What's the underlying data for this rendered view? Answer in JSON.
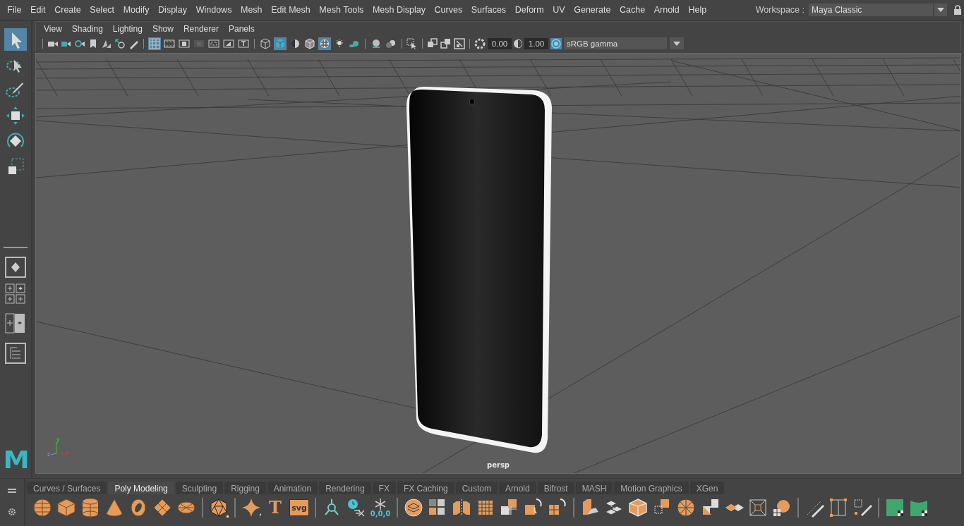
{
  "menu_bar": {
    "items": [
      "File",
      "Edit",
      "Create",
      "Select",
      "Modify",
      "Display",
      "Windows",
      "Mesh",
      "Edit Mesh",
      "Mesh Tools",
      "Mesh Display",
      "Curves",
      "Surfaces",
      "Deform",
      "UV",
      "Generate",
      "Cache",
      "Arnold",
      "Help"
    ],
    "workspace": {
      "label": "Workspace :",
      "value": "Maya Classic"
    }
  },
  "toolbox": {
    "tools": [
      {
        "kind": "select",
        "selected": true
      },
      {
        "kind": "lasso",
        "selected": false
      },
      {
        "kind": "paint",
        "selected": false
      },
      {
        "kind": "move",
        "selected": false
      },
      {
        "kind": "rotate",
        "selected": false
      },
      {
        "kind": "scale",
        "selected": false
      }
    ]
  },
  "logo": "M",
  "panel": {
    "menus": [
      "View",
      "Shading",
      "Lighting",
      "Show",
      "Renderer",
      "Panels"
    ],
    "toggles": [
      {
        "on": true
      },
      {
        "on": false
      },
      {
        "on": false
      },
      {
        "on": false
      },
      {
        "on": false
      },
      {
        "on": false
      },
      {
        "on": false
      },
      {
        "on": false
      },
      {
        "on": true
      },
      {
        "on": false
      },
      {
        "on": false
      },
      {
        "on": true
      },
      {
        "on": false
      },
      {
        "on": false
      },
      {
        "on": false
      },
      {
        "on": false
      }
    ],
    "exposure": "0.00",
    "gamma": "1.00",
    "color_management_on": true,
    "color_space": "sRGB gamma"
  },
  "viewport": {
    "camera_label": "persp",
    "axes": [
      "x",
      "y",
      "z"
    ]
  },
  "shelf": {
    "tabs": [
      {
        "label": "Curves / Surfaces",
        "selected": false
      },
      {
        "label": "Poly Modeling",
        "selected": true
      },
      {
        "label": "Sculpting",
        "selected": false
      },
      {
        "label": "Rigging",
        "selected": false
      },
      {
        "label": "Animation",
        "selected": false
      },
      {
        "label": "Rendering",
        "selected": false
      },
      {
        "label": "FX",
        "selected": false
      },
      {
        "label": "FX Caching",
        "selected": false
      },
      {
        "label": "Custom",
        "selected": false
      },
      {
        "label": "Arnold",
        "selected": false
      },
      {
        "label": "Bifrost",
        "selected": false
      },
      {
        "label": "MASH",
        "selected": false
      },
      {
        "label": "Motion Graphics",
        "selected": false
      },
      {
        "label": "XGen",
        "selected": false
      }
    ],
    "type_label": "T",
    "svg_label": "svg",
    "freeze_label": "0,0,0"
  }
}
